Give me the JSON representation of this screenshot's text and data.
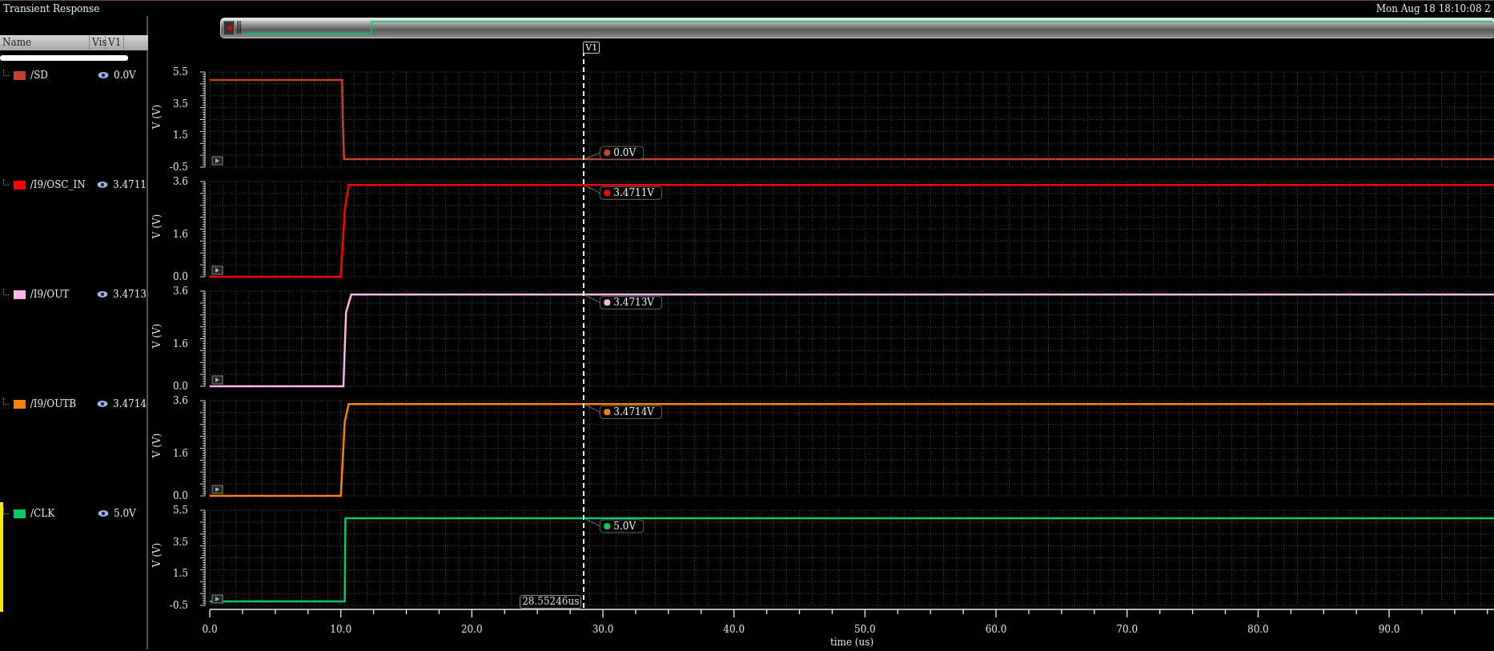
{
  "window": {
    "title": "Transient Response",
    "clock": "Mon Aug 18 18:10:08 2"
  },
  "signal_list": {
    "columns": [
      "Name",
      "Vis",
      "V1"
    ]
  },
  "cursor": {
    "label": "V1",
    "readout": "28.55246us"
  },
  "signals": [
    {
      "name": "/SD",
      "color": "#c0442a",
      "visible": true,
      "value": "0.0V",
      "selected": false,
      "chart_data": {
        "type": "line",
        "ylabel": "V (V)",
        "x": [
          0,
          10.1,
          10.15,
          10.25,
          98
        ],
        "series": [
          {
            "color": "#c0442a",
            "values": [
              5,
              5,
              2.5,
              0,
              0
            ]
          }
        ],
        "xlim": [
          0,
          98
        ],
        "ylim": [
          -0.5,
          5.5
        ],
        "yticks": [
          {
            "value": 5.5,
            "label": "5.5"
          },
          {
            "value": 3.5,
            "label": "3.5"
          },
          {
            "value": 1.5,
            "label": "1.5"
          },
          {
            "value": -0.5,
            "label": "-0.5"
          }
        ],
        "grid": true,
        "annotations": [
          "0.0V"
        ]
      }
    },
    {
      "name": "/I9/OSC_IN",
      "color": "#ff0000",
      "visible": true,
      "value": "3.4711",
      "selected": false,
      "chart_data": {
        "type": "line",
        "ylabel": "V (V)",
        "x": [
          0,
          10.0,
          10.3,
          10.6,
          98
        ],
        "series": [
          {
            "color": "#ff0000",
            "values": [
              0,
              0,
              2.5,
              3.47,
              3.47
            ]
          }
        ],
        "xlim": [
          0,
          98
        ],
        "ylim": [
          0,
          3.6
        ],
        "yticks": [
          {
            "value": 3.6,
            "label": "3.6"
          },
          {
            "value": 1.6,
            "label": "1.6"
          },
          {
            "value": 0,
            "label": "0.0"
          }
        ],
        "grid": true,
        "annotations": [
          "3.4711V"
        ]
      }
    },
    {
      "name": "/I9/OUT",
      "color": "#ffb3e8",
      "visible": true,
      "value": "3.4713",
      "selected": false,
      "chart_data": {
        "type": "line",
        "ylabel": "V (V)",
        "x": [
          0,
          10.2,
          10.4,
          10.8,
          98
        ],
        "series": [
          {
            "color": "#ffb3e8",
            "values": [
              0,
              0,
              2.8,
              3.47,
              3.47
            ]
          }
        ],
        "xlim": [
          0,
          98
        ],
        "ylim": [
          0,
          3.6
        ],
        "yticks": [
          {
            "value": 3.6,
            "label": "3.6"
          },
          {
            "value": 1.6,
            "label": "1.6"
          },
          {
            "value": 0,
            "label": "0.0"
          }
        ],
        "grid": true,
        "annotations": [
          "3.4713V"
        ]
      }
    },
    {
      "name": "/I9/OUTB",
      "color": "#ff8000",
      "visible": true,
      "value": "3.4714",
      "selected": false,
      "chart_data": {
        "type": "line",
        "ylabel": "V (V)",
        "x": [
          0,
          10.0,
          10.3,
          10.6,
          98
        ],
        "series": [
          {
            "color": "#ff8000",
            "values": [
              0,
              0,
              2.8,
              3.47,
              3.47
            ]
          }
        ],
        "xlim": [
          0,
          98
        ],
        "ylim": [
          0,
          3.6
        ],
        "yticks": [
          {
            "value": 3.6,
            "label": "3.6"
          },
          {
            "value": 1.6,
            "label": "1.6"
          },
          {
            "value": 0,
            "label": "0.0"
          }
        ],
        "grid": true,
        "annotations": [
          "3.4714V"
        ]
      }
    },
    {
      "name": "/CLK",
      "color": "#00cc66",
      "visible": true,
      "value": "5.0V",
      "selected": true,
      "chart_data": {
        "type": "line",
        "ylabel": "V (V)",
        "xlabel": "time (us)",
        "x": [
          0,
          10.3,
          10.35,
          98
        ],
        "series": [
          {
            "color": "#00cc66",
            "values": [
              -0.25,
              -0.25,
              5,
              5
            ]
          }
        ],
        "xlim": [
          0,
          98
        ],
        "ylim": [
          -0.5,
          5.5
        ],
        "xticks": [
          {
            "value": 0,
            "label": "0.0"
          },
          {
            "value": 10,
            "label": "10.0"
          },
          {
            "value": 20,
            "label": "20.0"
          },
          {
            "value": 30,
            "label": "30.0"
          },
          {
            "value": 40,
            "label": "40.0"
          },
          {
            "value": 50,
            "label": "50.0"
          },
          {
            "value": 60,
            "label": "60.0"
          },
          {
            "value": 70,
            "label": "70.0"
          },
          {
            "value": 80,
            "label": "80.0"
          },
          {
            "value": 90,
            "label": "90.0"
          }
        ],
        "yticks": [
          {
            "value": 5.5,
            "label": "5.5"
          },
          {
            "value": 3.5,
            "label": "3.5"
          },
          {
            "value": 1.5,
            "label": "1.5"
          },
          {
            "value": -0.5,
            "label": "-0.5"
          }
        ],
        "grid": true,
        "annotations": [
          "5.0V"
        ]
      }
    }
  ]
}
